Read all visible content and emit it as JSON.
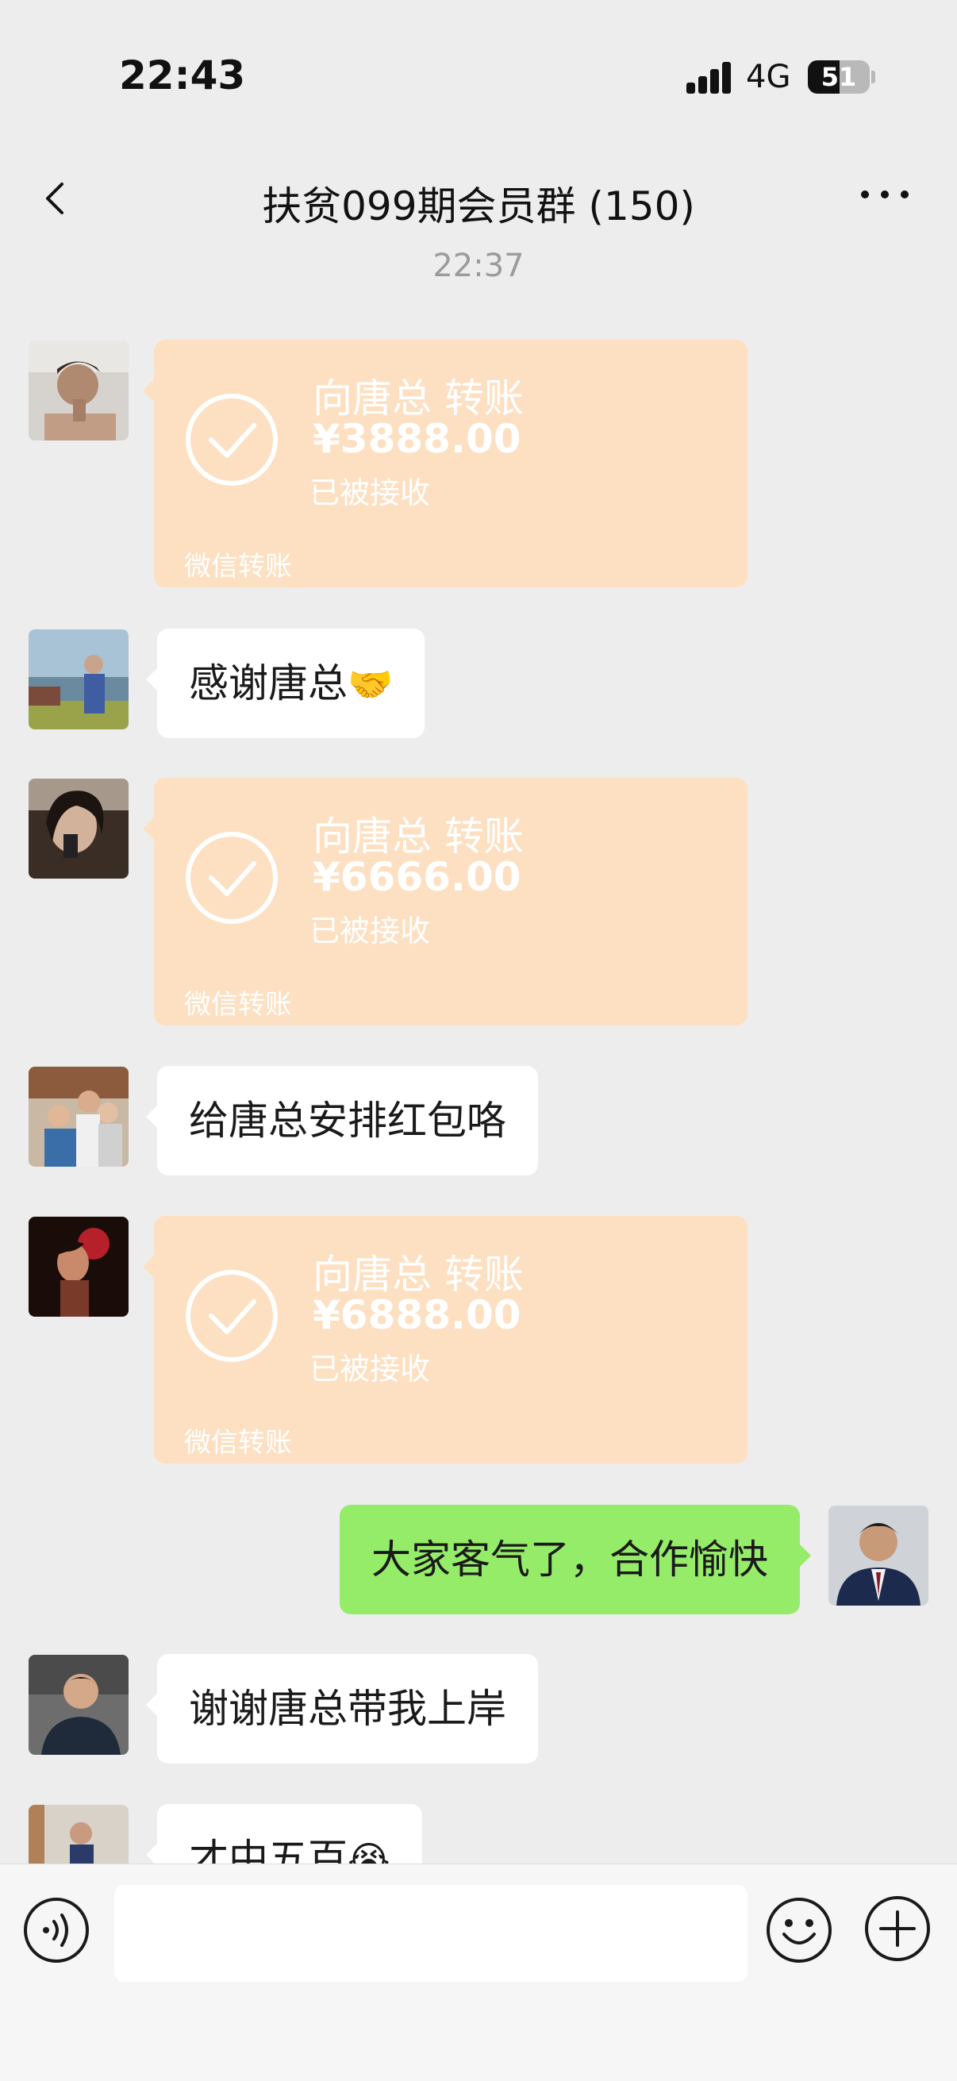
{
  "status_bar": {
    "time": "22:43",
    "network": "4G",
    "battery": "51",
    "battery_level": 0.51
  },
  "nav": {
    "title": "扶贫099期会员群 (150)"
  },
  "timestamp": "22:37",
  "messages": [
    {
      "type": "transfer",
      "title": "向唐总 转账",
      "amount": "¥3888.00",
      "status": "已被接收",
      "label": "微信转账"
    },
    {
      "type": "text",
      "text": "感谢唐总",
      "emoji": "🤝"
    },
    {
      "type": "transfer",
      "title": "向唐总 转账",
      "amount": "¥6666.00",
      "status": "已被接收",
      "label": "微信转账"
    },
    {
      "type": "text",
      "text": "给唐总安排红包咯"
    },
    {
      "type": "transfer",
      "title": "向唐总 转账",
      "amount": "¥6888.00",
      "status": "已被接收",
      "label": "微信转账"
    },
    {
      "type": "text",
      "text": "大家客气了，合作愉快",
      "self": true
    },
    {
      "type": "text",
      "text": "谢谢唐总带我上岸"
    },
    {
      "type": "text",
      "text": "才中五百",
      "emoji": "😭"
    }
  ],
  "colors": {
    "self_bubble": "#95ec69",
    "transfer_card": "#fde0c2",
    "background": "#ededed"
  },
  "icons": [
    "back-icon",
    "more-icon",
    "check-icon",
    "voice-icon",
    "emoji-icon",
    "plus-icon"
  ]
}
